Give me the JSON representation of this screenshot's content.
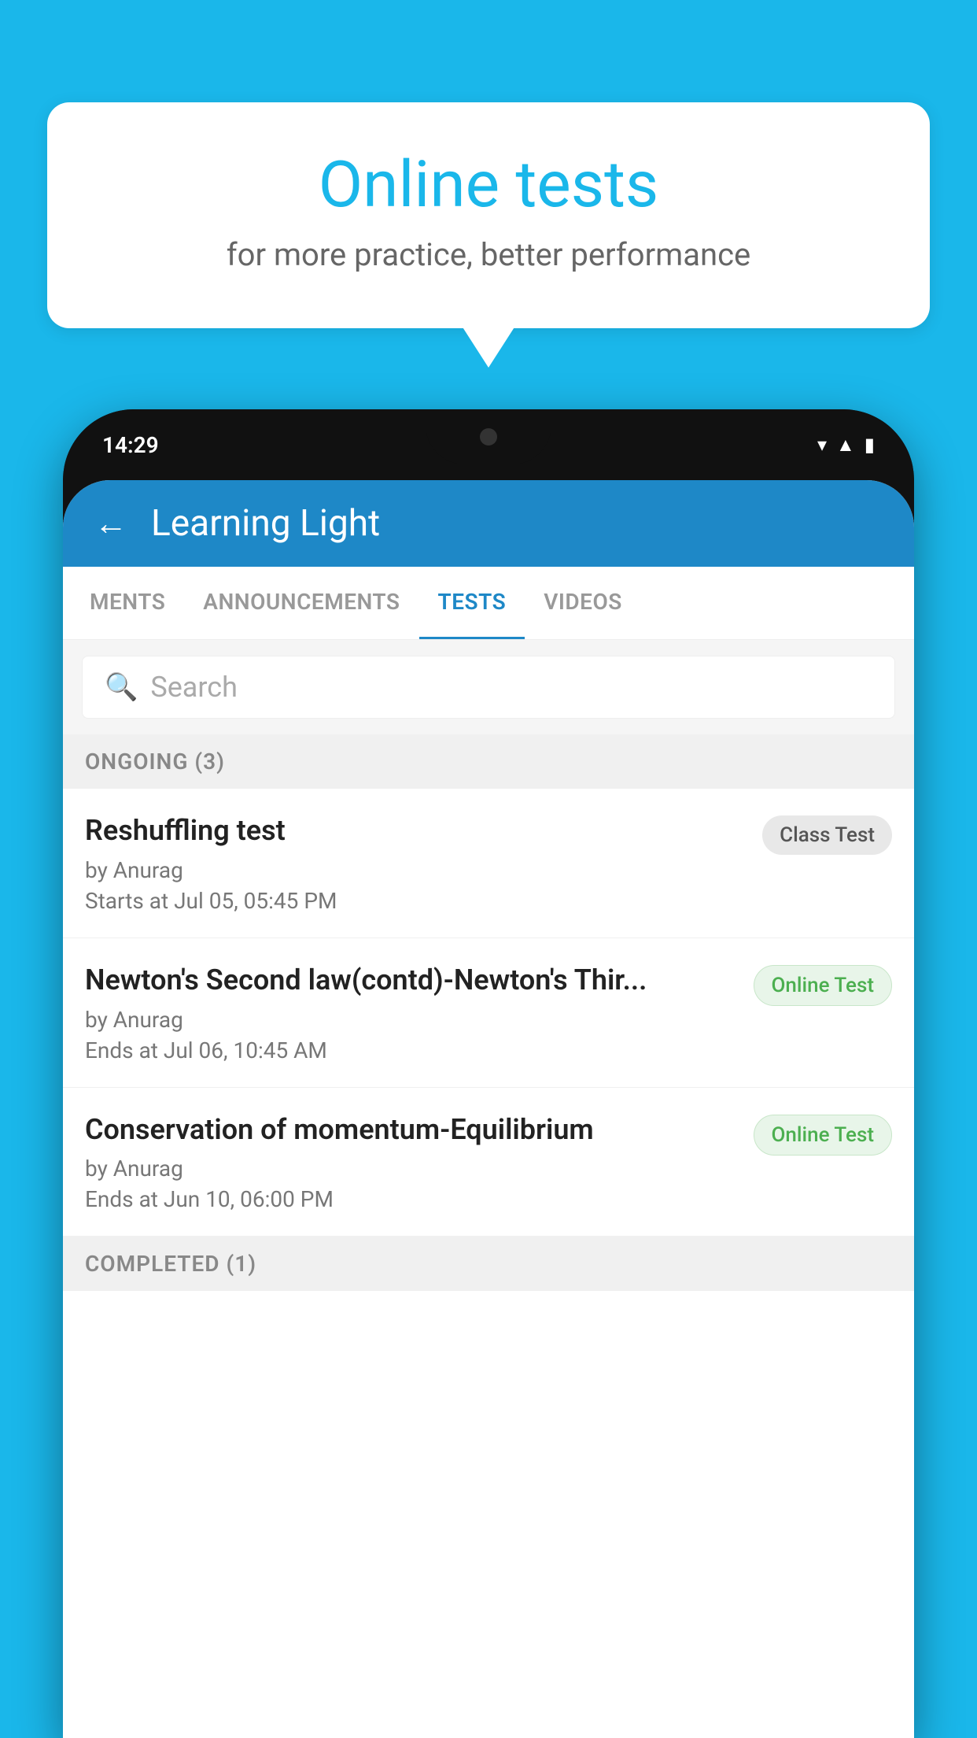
{
  "background_color": "#1ab7ea",
  "speech_bubble": {
    "title": "Online tests",
    "subtitle": "for more practice, better performance"
  },
  "phone": {
    "status_bar": {
      "time": "14:29",
      "icons": [
        "wifi",
        "signal",
        "battery"
      ]
    },
    "app_bar": {
      "title": "Learning Light",
      "back_label": "←"
    },
    "tabs": [
      {
        "label": "MENTS",
        "active": false
      },
      {
        "label": "ANNOUNCEMENTS",
        "active": false
      },
      {
        "label": "TESTS",
        "active": true
      },
      {
        "label": "VIDEOS",
        "active": false
      }
    ],
    "search": {
      "placeholder": "Search"
    },
    "ongoing_section": {
      "label": "ONGOING (3)",
      "tests": [
        {
          "title": "Reshuffling test",
          "author": "by Anurag",
          "date": "Starts at  Jul 05, 05:45 PM",
          "badge": "Class Test",
          "badge_type": "class"
        },
        {
          "title": "Newton's Second law(contd)-Newton's Thir...",
          "author": "by Anurag",
          "date": "Ends at  Jul 06, 10:45 AM",
          "badge": "Online Test",
          "badge_type": "online"
        },
        {
          "title": "Conservation of momentum-Equilibrium",
          "author": "by Anurag",
          "date": "Ends at  Jun 10, 06:00 PM",
          "badge": "Online Test",
          "badge_type": "online"
        }
      ]
    },
    "completed_section": {
      "label": "COMPLETED (1)"
    }
  }
}
